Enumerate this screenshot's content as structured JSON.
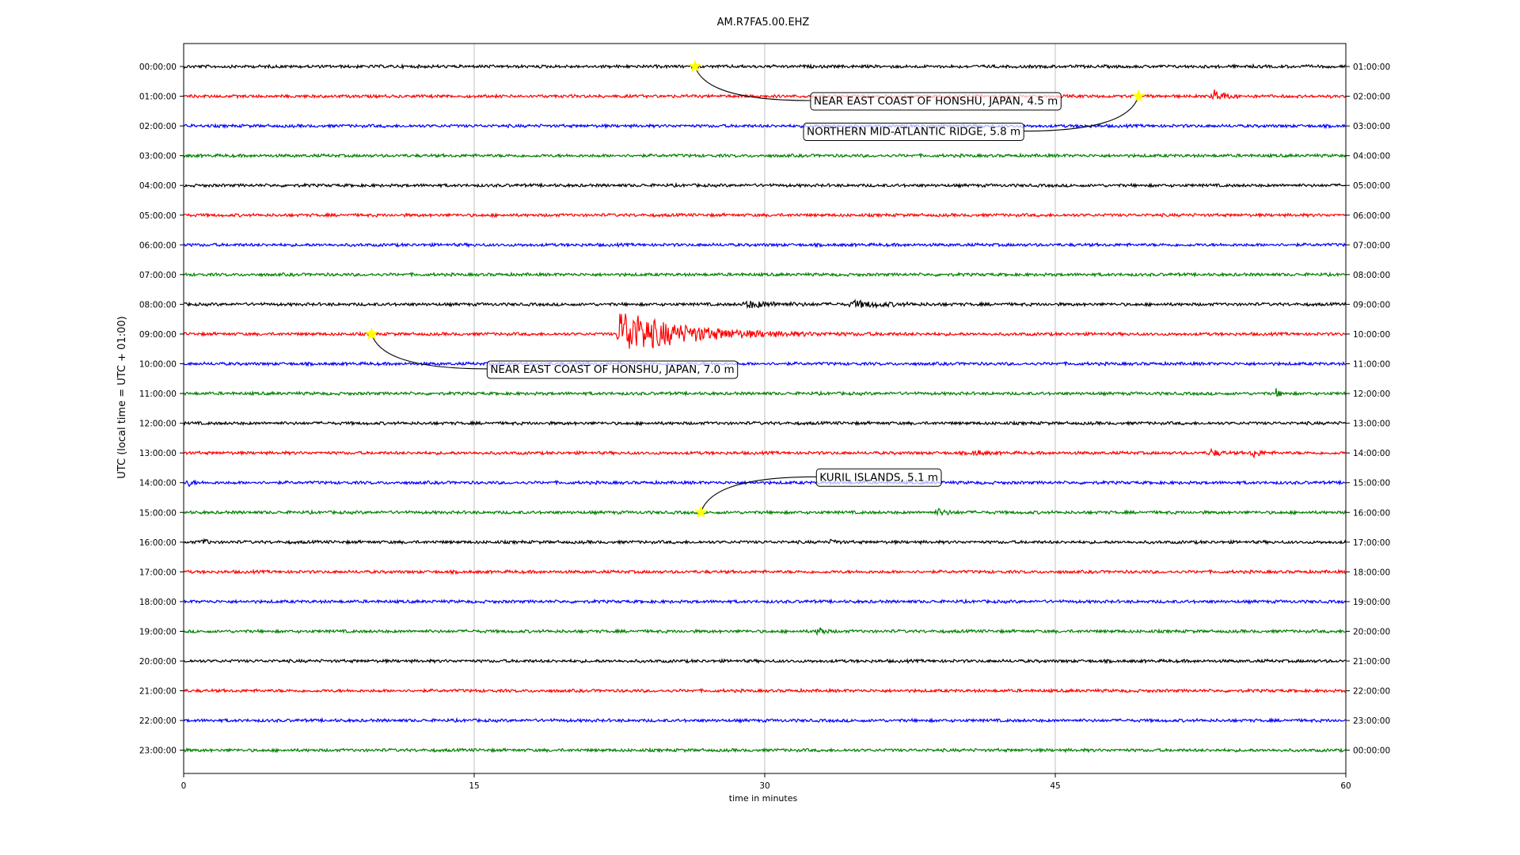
{
  "chart_data": {
    "type": "line",
    "title": "AM.R7FA5.00.EHZ",
    "xlabel": "time in minutes",
    "ylabel": "UTC (local time = UTC + 01:00)",
    "xlim": [
      0,
      60
    ],
    "x_ticks": [
      0,
      15,
      30,
      45,
      60
    ],
    "grid": "vertical",
    "trace_colors": [
      "#000000",
      "#ff0000",
      "#0000ff",
      "#008000"
    ],
    "left_tick_labels": [
      "00:00:00",
      "01:00:00",
      "02:00:00",
      "03:00:00",
      "04:00:00",
      "05:00:00",
      "06:00:00",
      "07:00:00",
      "08:00:00",
      "09:00:00",
      "10:00:00",
      "11:00:00",
      "12:00:00",
      "13:00:00",
      "14:00:00",
      "15:00:00",
      "16:00:00",
      "17:00:00",
      "18:00:00",
      "19:00:00",
      "20:00:00",
      "21:00:00",
      "22:00:00",
      "23:00:00"
    ],
    "right_tick_labels": [
      "01:00:00",
      "02:00:00",
      "03:00:00",
      "04:00:00",
      "05:00:00",
      "06:00:00",
      "07:00:00",
      "08:00:00",
      "09:00:00",
      "10:00:00",
      "11:00:00",
      "12:00:00",
      "13:00:00",
      "14:00:00",
      "15:00:00",
      "16:00:00",
      "17:00:00",
      "18:00:00",
      "19:00:00",
      "20:00:00",
      "21:00:00",
      "22:00:00",
      "23:00:00",
      "00:00:00"
    ],
    "bursts": [
      {
        "row": 1,
        "minute": 53.2,
        "amplitude": 8,
        "decay": 0.45
      },
      {
        "row": 9,
        "minute": 22.5,
        "amplitude": 30,
        "decay": 3.0
      },
      {
        "row": 8,
        "minute": 29.0,
        "amplitude": 4,
        "decay": 1.5
      },
      {
        "row": 8,
        "minute": 34.5,
        "amplitude": 4,
        "decay": 1.5
      },
      {
        "row": 13,
        "minute": 53.0,
        "amplitude": 5,
        "decay": 0.4
      },
      {
        "row": 13,
        "minute": 55.2,
        "amplitude": 6,
        "decay": 0.3
      },
      {
        "row": 13,
        "minute": 40.8,
        "amplitude": 4,
        "decay": 0.4
      },
      {
        "row": 14,
        "minute": 0.2,
        "amplitude": 5,
        "decay": 0.2
      },
      {
        "row": 15,
        "minute": 38.9,
        "amplitude": 4,
        "decay": 0.5
      },
      {
        "row": 16,
        "minute": 1.0,
        "amplitude": 6,
        "decay": 0.15
      },
      {
        "row": 16,
        "minute": 33.5,
        "amplitude": 6,
        "decay": 0.15
      },
      {
        "row": 19,
        "minute": 32.8,
        "amplitude": 9,
        "decay": 0.2
      },
      {
        "row": 11,
        "minute": 56.4,
        "amplitude": 5,
        "decay": 0.2
      }
    ],
    "events": [
      {
        "row": 0,
        "minute": 26.4,
        "label": "NEAR EAST COAST OF HONSHU, JAPAN, 4.5 m",
        "label_anchor": "left"
      },
      {
        "row": 1,
        "minute": 49.3,
        "label": "NORTHERN MID-ATLANTIC RIDGE, 5.8 m",
        "label_anchor": "right"
      },
      {
        "row": 9,
        "minute": 9.7,
        "label": "NEAR EAST COAST OF HONSHU, JAPAN, 7.0 m",
        "label_anchor": "left"
      },
      {
        "row": 15,
        "minute": 26.7,
        "label": "KURIL ISLANDS, 5.1 m",
        "label_anchor": "left"
      }
    ]
  }
}
